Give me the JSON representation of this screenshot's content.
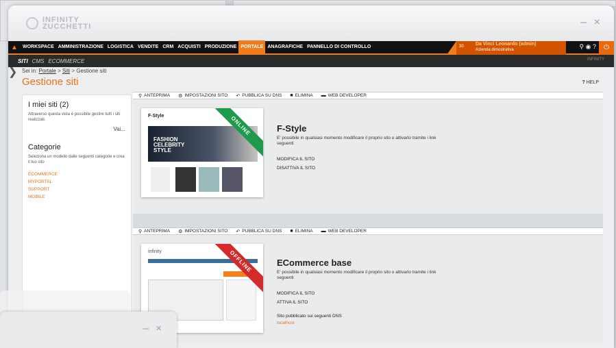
{
  "window": {
    "logo_line1": "INFINITY",
    "logo_line2": "ZUCCHETTI",
    "min_label": "–",
    "close_label": "×"
  },
  "menu": {
    "items": [
      "WORKSPACE",
      "AMMINISTRAZIONE",
      "LOGISTICA",
      "VENDITE",
      "CRM",
      "ACQUISTI",
      "PRODUZIONE",
      "PORTALE",
      "ANAGRAFICHE",
      "PANNELLO DI CONTROLLO"
    ],
    "active": "PORTALE",
    "badge": "30",
    "user_name": "Da Vinci Leonardo (admin)",
    "company": "Azienda dimostrativa"
  },
  "submenu": {
    "items": [
      "SITI",
      "CMS",
      "ECOMMERCE"
    ],
    "active": "SITI",
    "logo": "INFINITY"
  },
  "breadcrumb": {
    "prefix": "Sei in:",
    "l1": "Portale",
    "sep": ">",
    "l2": "Siti",
    "current": "Gestione siti"
  },
  "page_title": "Gestione siti",
  "help": "HELP",
  "left_panel": {
    "title": "I miei siti (2)",
    "text": "Attraverso questa vista è possibile gestire tutti i siti realizzati.",
    "link": "Vai...",
    "cat_title": "Categorie",
    "cat_text": "Seleziona un modello dalle seguenti categorie e crea il tuo sito",
    "categories": [
      "ECOMMERCE",
      "MYPORTAL",
      "SUPPORT",
      "MOBILE"
    ]
  },
  "toolbar": {
    "preview": "ANTEPRIMA",
    "settings": "IMPOSTAZIONI SITO",
    "publish": "PUBBLICA SU DNS",
    "delete": "ELIMINA",
    "webdev": "WEB DEVELOPER"
  },
  "sites": [
    {
      "name": "F-Style",
      "status": "ONLINE",
      "desc": "E' possibile in qualsiasi momento modificare il proprio sito o attivarlo tramite i link seguenti",
      "edit": "MODIFICA IL SITO",
      "toggle": "DISATTIVA IL SITO",
      "thumb_brand": "F-Style",
      "thumb_hero": "FASHION CELEBRITY STYLE"
    },
    {
      "name": "ECommerce base",
      "status": "OFFLINE",
      "desc": "E' possibile in qualsiasi momento modificare il proprio sito o attivarlo tramite i link seguenti",
      "edit": "MODIFICA IL SITO",
      "toggle": "ATTIVA IL SITO",
      "dns_text": "Sito pubblicato sui seguenti DNS",
      "dns_link": "localhost",
      "thumb_brand": "infinity"
    }
  ],
  "colors": {
    "accent": "#f07c1a",
    "online": "#1d9a4a",
    "offline": "#d42a2a"
  }
}
